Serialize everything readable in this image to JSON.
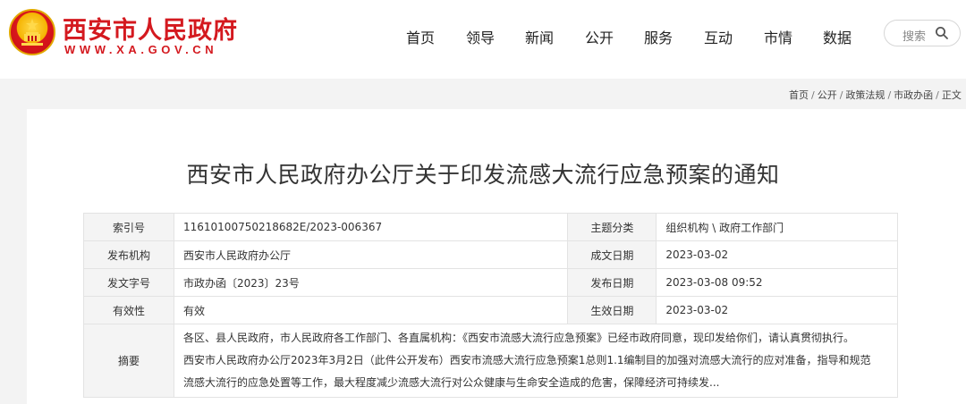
{
  "site": {
    "name": "西安市人民政府",
    "url": "WWW.XA.GOV.CN",
    "brand_color": "#d4191f"
  },
  "nav": {
    "items": [
      "首页",
      "领导",
      "新闻",
      "公开",
      "服务",
      "互动",
      "市情",
      "数据"
    ]
  },
  "search": {
    "label": "搜索",
    "icon": "search-icon"
  },
  "breadcrumb": {
    "items": [
      "首页",
      "公开",
      "政策法规",
      "市政办函",
      "正文"
    ],
    "separator": "/"
  },
  "article": {
    "title": "西安市人民政府办公厅关于印发流感大流行应急预案的通知"
  },
  "meta": {
    "rows": [
      {
        "l1": "索引号",
        "v1": "11610100750218682E/2023-006367",
        "l2": "主题分类",
        "v2": "组织机构 \\ 政府工作部门"
      },
      {
        "l1": "发布机构",
        "v1": "西安市人民政府办公厅",
        "l2": "成文日期",
        "v2": "2023-03-02"
      },
      {
        "l1": "发文字号",
        "v1": "市政办函〔2023〕23号",
        "l2": "发布日期",
        "v2": "2023-03-08 09:52"
      },
      {
        "l1": "有效性",
        "v1": "有效",
        "l2": "生效日期",
        "v2": "2023-03-02"
      }
    ],
    "summary_label": "摘要",
    "summary_lines": [
      "各区、县人民政府，市人民政府各工作部门、各直属机构：《西安市流感大流行应急预案》已经市政府同意，现印发给你们，请认真贯彻执行。",
      "西安市人民政府办公厅2023年3月2日（此件公开发布）西安市流感大流行应急预案1总则1.1编制目的加强对流感大流行的应对准备，指导和规范",
      "流感大流行的应急处置等工作，最大程度减少流感大流行对公众健康与生命安全造成的危害，保障经济可持续发..."
    ]
  }
}
